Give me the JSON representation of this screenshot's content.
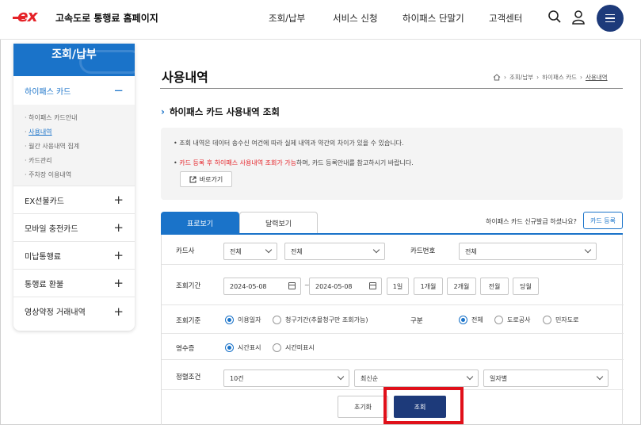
{
  "header": {
    "logo_text": "ex",
    "site_title": "고속도로 통행료 홈페이지",
    "nav": [
      "조회/납부",
      "서비스 신청",
      "하이패스 단말기",
      "고객센터"
    ],
    "icons": [
      "search-icon",
      "user-icon",
      "menu-icon"
    ]
  },
  "sidebar": {
    "title": "조회/납부",
    "active_item": {
      "label": "하이패스 카드",
      "toggle": "−"
    },
    "sub_items": [
      "하이패스 카드안내",
      "사용내역",
      "월간 사용내역 집계",
      "카드관리",
      "주차장 이용내역"
    ],
    "current_sub": "사용내역",
    "items": [
      {
        "label": "EX선불카드",
        "toggle": "+"
      },
      {
        "label": "모바일 충전카드",
        "toggle": "+"
      },
      {
        "label": "미납통행료",
        "toggle": "+"
      },
      {
        "label": "통행료 환불",
        "toggle": "+"
      },
      {
        "label": "영상약정 거래내역",
        "toggle": "+"
      }
    ]
  },
  "page": {
    "title": "사용내역",
    "breadcrumb": [
      "조회/납부",
      "하이패스 카드",
      "사용내역"
    ],
    "section_title": "하이패스 카드 사용내역 조회"
  },
  "notice": {
    "line1": "조회 내역은 데이터 송수신 여건에 따라 실제 내역과 약간의 차이가 있을 수 있습니다.",
    "line2_red": "카드 등록 후 하이패스 사용내역 조회가 가능",
    "line2_rest": "하며, 카드 등록안내를 참고하시기 바랍니다.",
    "shortcut_label": "바로가기"
  },
  "tabs": {
    "list": "표로보기",
    "calendar": "달력보기"
  },
  "new_card_question": "하이패스 카드 신규발급 하셨나요?",
  "card_register_button": "카드 등록",
  "form": {
    "card_company_label": "카드사",
    "card_company_value": "전체",
    "card_company_sub_value": "전체",
    "card_number_label": "카드번호",
    "card_number_value": "전체",
    "period_label": "조회기간",
    "date_from": "2024-05-08",
    "date_sep": "~",
    "date_to": "2024-05-08",
    "period_buttons": [
      "1일",
      "1개월",
      "2개월",
      "전월",
      "당월"
    ],
    "criteria_label": "조회기준",
    "criteria_options": [
      "이용일자",
      "청구기간(추몰청구만 조회가능)"
    ],
    "division_label": "구분",
    "division_options": [
      "전체",
      "도로공사",
      "민자도로"
    ],
    "receipt_label": "영수증",
    "receipt_options": [
      "시간표시",
      "시간미표시"
    ],
    "sort_label": "정렬조건",
    "sort_count": "10건",
    "sort_order": "최신순",
    "sort_by": "일자별"
  },
  "buttons": {
    "reset": "초기화",
    "search": "조회"
  },
  "colors": {
    "brand_blue": "#1a73c9",
    "navy": "#1d3a7a",
    "brand_red": "#e52228",
    "highlight_red": "#e0101a"
  }
}
